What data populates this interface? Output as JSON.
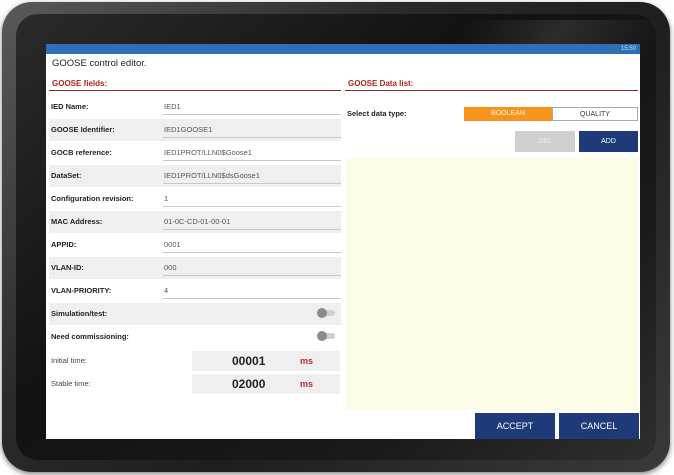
{
  "status": {
    "text": "15:50"
  },
  "dialog": {
    "title": "GOOSE control editor."
  },
  "sections": {
    "fields": "GOOSE fields:",
    "data_list": "GOOSE Data list:"
  },
  "fields": [
    {
      "label": "IED Name:",
      "value": "IED1"
    },
    {
      "label": "GOOSE Identifier:",
      "value": "IED1GOOSE1"
    },
    {
      "label": "GOCB reference:",
      "value": "IED1PROT/LLN0$Goose1"
    },
    {
      "label": "DataSet:",
      "value": "IED1PROT/LLN0$dsGoose1"
    },
    {
      "label": "Configuration revision:",
      "value": "1"
    },
    {
      "label": "MAC Address:",
      "value": "01-0C-CD-01-00-01"
    },
    {
      "label": "APPID:",
      "value": "0001"
    },
    {
      "label": "VLAN-ID:",
      "value": "000"
    },
    {
      "label": "VLAN-PRIORITY:",
      "value": "4"
    }
  ],
  "toggles": [
    {
      "label": "Simulation/test:",
      "on": false
    },
    {
      "label": "Need commissioning:",
      "on": false
    }
  ],
  "times": [
    {
      "label": "Initial time:",
      "value": "00001",
      "unit": "ms"
    },
    {
      "label": "Stable time:",
      "value": "02000",
      "unit": "ms"
    }
  ],
  "datatype": {
    "label": "Select data type:",
    "options": [
      "BOOLEAN",
      "QUALITY"
    ],
    "selected": "BOOLEAN"
  },
  "buttons": {
    "del": "DEL",
    "add": "ADD",
    "accept": "ACCEPT",
    "cancel": "CANCEL"
  },
  "colors": {
    "accent": "#f7941d",
    "primary_button": "#1f3a78",
    "section_title": "#a8271f",
    "statusbar": "#2f6fb5",
    "data_area": "#fbfbe6"
  }
}
